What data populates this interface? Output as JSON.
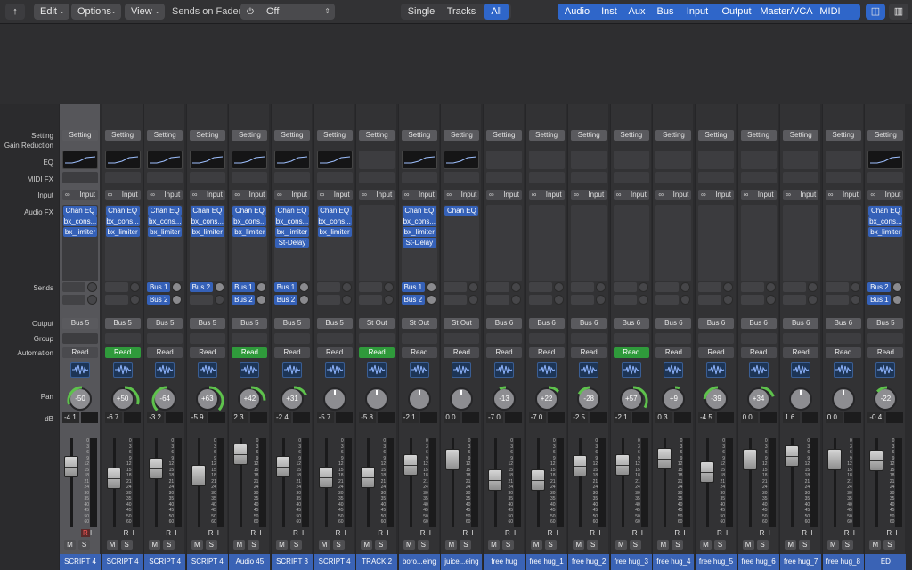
{
  "toolbar": {
    "edit": "Edit",
    "options": "Options",
    "view": "View",
    "sends_label": "Sends on Faders:",
    "sends_value": "Off",
    "single": "Single",
    "tracks": "Tracks",
    "all": "All",
    "filters": [
      "Audio",
      "Inst",
      "Aux",
      "Bus",
      "Input",
      "Output",
      "Master/VCA",
      "MIDI"
    ]
  },
  "labels": {
    "setting": "Setting",
    "gain_reduction": "Gain Reduction",
    "eq": "EQ",
    "midi_fx": "MIDI FX",
    "input": "Input",
    "audio_fx": "Audio FX",
    "sends": "Sends",
    "output": "Output",
    "group": "Group",
    "automation": "Automation",
    "pan": "Pan",
    "db": "dB"
  },
  "strip_common": {
    "setting": "Setting",
    "input": "Input",
    "m": "M",
    "s": "S",
    "r": "R",
    "i": "I"
  },
  "scale_ticks": [
    "0",
    "3",
    "6",
    "9",
    "12",
    "15",
    "18",
    "21",
    "24",
    "30",
    "35",
    "40",
    "45",
    "50",
    "60"
  ],
  "strips": [
    {
      "name": "SCRIPT 4",
      "eq": true,
      "fx": [
        "Chan EQ",
        "bx_cons...",
        "bx_limiter"
      ],
      "sends": [],
      "output": "Bus 5",
      "auto": "Read",
      "auto_green": false,
      "pan": "-50",
      "db": "-4.1",
      "fader": 0.68,
      "rec": true,
      "selected": true
    },
    {
      "name": "SCRIPT 4",
      "eq": true,
      "fx": [
        "Chan EQ",
        "bx_cons...",
        "bx_limiter"
      ],
      "sends": [],
      "output": "Bus 5",
      "auto": "Read",
      "auto_green": true,
      "pan": "+50",
      "db": "-6.7",
      "fader": 0.55,
      "rec": false
    },
    {
      "name": "SCRIPT 4",
      "eq": true,
      "fx": [
        "Chan EQ",
        "bx_cons...",
        "bx_limiter"
      ],
      "sends": [
        "Bus 1",
        "Bus 2"
      ],
      "output": "Bus 5",
      "auto": "Read",
      "auto_green": false,
      "pan": "-64",
      "db": "-3.2",
      "fader": 0.66,
      "rec": false
    },
    {
      "name": "SCRIPT 4",
      "eq": true,
      "fx": [
        "Chan EQ",
        "bx_cons...",
        "bx_limiter"
      ],
      "sends": [
        "Bus 2"
      ],
      "output": "Bus 5",
      "auto": "Read",
      "auto_green": false,
      "pan": "+63",
      "db": "-5.9",
      "fader": 0.58,
      "rec": false
    },
    {
      "name": "Audio 45",
      "eq": true,
      "fx": [
        "Chan EQ",
        "bx_cons...",
        "bx_limiter"
      ],
      "sends": [
        "Bus 1",
        "Bus 2"
      ],
      "output": "Bus 5",
      "auto": "Read",
      "auto_green": true,
      "pan": "+42",
      "db": "2.3",
      "fader": 0.82,
      "rec": false
    },
    {
      "name": "SCRIPT 3",
      "eq": true,
      "fx": [
        "Chan EQ",
        "bx_cons...",
        "bx_limiter",
        "St-Delay"
      ],
      "sends": [
        "Bus 1",
        "Bus 2"
      ],
      "output": "Bus 5",
      "auto": "Read",
      "auto_green": false,
      "pan": "+31",
      "db": "-2.4",
      "fader": 0.68,
      "rec": false
    },
    {
      "name": "SCRIPT 4",
      "eq": true,
      "fx": [
        "Chan EQ",
        "bx_cons...",
        "bx_limiter"
      ],
      "sends": [],
      "output": "Bus 5",
      "auto": "Read",
      "auto_green": false,
      "pan": "",
      "db": "-5.7",
      "fader": 0.56,
      "rec": false
    },
    {
      "name": "TRACK 2",
      "eq": false,
      "fx": [],
      "sends": [],
      "output": "St Out",
      "auto": "Read",
      "auto_green": true,
      "pan": "",
      "db": "-5.8",
      "fader": 0.56,
      "rec": false
    },
    {
      "name": "boro...eing",
      "eq": true,
      "fx": [
        "Chan EQ",
        "bx_cons...",
        "bx_limiter",
        "St-Delay"
      ],
      "sends": [
        "Bus 1",
        "Bus 2"
      ],
      "output": "St Out",
      "auto": "Read",
      "auto_green": false,
      "pan": "",
      "db": "-2.1",
      "fader": 0.7,
      "rec": false
    },
    {
      "name": "juice...eing",
      "eq": true,
      "fx": [
        "Chan EQ"
      ],
      "sends": [],
      "output": "St Out",
      "auto": "Read",
      "auto_green": false,
      "pan": "",
      "db": "0.0",
      "fader": 0.76,
      "rec": false
    },
    {
      "name": "free hug",
      "eq": false,
      "fx": [],
      "sends": [],
      "output": "Bus 6",
      "auto": "Read",
      "auto_green": false,
      "pan": "-13",
      "db": "-7.0",
      "fader": 0.53,
      "rec": false
    },
    {
      "name": "free hug_1",
      "eq": false,
      "fx": [],
      "sends": [],
      "output": "Bus 6",
      "auto": "Read",
      "auto_green": false,
      "pan": "+22",
      "db": "-7.0",
      "fader": 0.53,
      "rec": false
    },
    {
      "name": "free hug_2",
      "eq": false,
      "fx": [],
      "sends": [],
      "output": "Bus 6",
      "auto": "Read",
      "auto_green": false,
      "pan": "-28",
      "db": "-2.5",
      "fader": 0.69,
      "rec": false
    },
    {
      "name": "free hug_3",
      "eq": false,
      "fx": [],
      "sends": [],
      "output": "Bus 6",
      "auto": "Read",
      "auto_green": true,
      "pan": "+57",
      "db": "-2.1",
      "fader": 0.7,
      "rec": false
    },
    {
      "name": "free hug_4",
      "eq": false,
      "fx": [],
      "sends": [],
      "output": "Bus 6",
      "auto": "Read",
      "auto_green": false,
      "pan": "+9",
      "db": "0.3",
      "fader": 0.77,
      "rec": false
    },
    {
      "name": "free hug_5",
      "eq": false,
      "fx": [],
      "sends": [],
      "output": "Bus 6",
      "auto": "Read",
      "auto_green": false,
      "pan": "-39",
      "db": "-4.5",
      "fader": 0.62,
      "rec": false
    },
    {
      "name": "free hug_6",
      "eq": false,
      "fx": [],
      "sends": [],
      "output": "Bus 6",
      "auto": "Read",
      "auto_green": false,
      "pan": "+34",
      "db": "0.0",
      "fader": 0.76,
      "rec": false
    },
    {
      "name": "free hug_7",
      "eq": false,
      "fx": [],
      "sends": [],
      "output": "Bus 6",
      "auto": "Read",
      "auto_green": false,
      "pan": "",
      "db": "1.6",
      "fader": 0.8,
      "rec": false
    },
    {
      "name": "free hug_8",
      "eq": false,
      "fx": [],
      "sends": [],
      "output": "Bus 6",
      "auto": "Read",
      "auto_green": false,
      "pan": "",
      "db": "0.0",
      "fader": 0.76,
      "rec": false
    },
    {
      "name": "ED",
      "eq": true,
      "fx": [
        "Chan EQ",
        "bx_cons...",
        "bx_limiter"
      ],
      "sends": [
        "Bus 2",
        "Bus 1"
      ],
      "output": "Bus 5",
      "auto": "Read",
      "auto_green": false,
      "pan": "-22",
      "db": "-0.4",
      "fader": 0.75,
      "rec": false
    }
  ]
}
